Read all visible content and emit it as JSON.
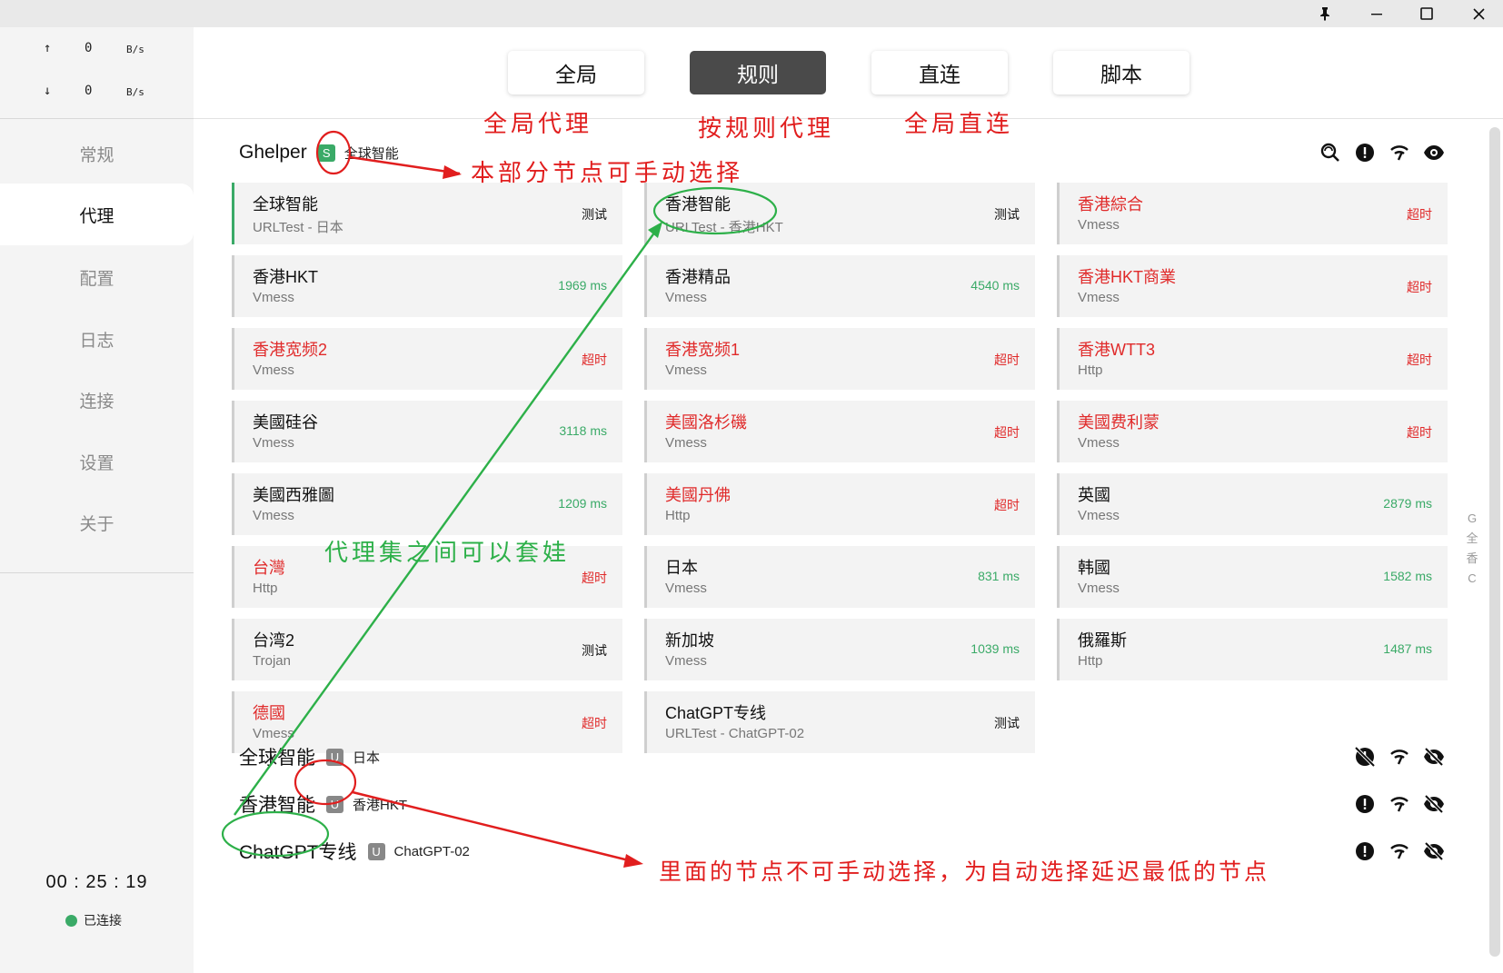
{
  "window": {
    "pin": "🖈",
    "minimize": "—",
    "maximize": "☐",
    "close": "✕"
  },
  "traffic": {
    "up": {
      "arrow": "↑",
      "value": "0",
      "unit": "B/s"
    },
    "down": {
      "arrow": "↓",
      "value": "0",
      "unit": "B/s"
    }
  },
  "sidebar": {
    "items": [
      {
        "label": "常规"
      },
      {
        "label": "代理"
      },
      {
        "label": "配置"
      },
      {
        "label": "日志"
      },
      {
        "label": "连接"
      },
      {
        "label": "设置"
      },
      {
        "label": "关于"
      }
    ],
    "active": "代理",
    "timer": "00 : 25 : 19",
    "status": "已连接",
    "status_color": "#3aaa67"
  },
  "modes": {
    "global": "全局",
    "rule": "规则",
    "direct": "直连",
    "script": "脚本",
    "active": "规则"
  },
  "groups": [
    {
      "name": "Ghelper",
      "badge": "S",
      "now": "全球智能",
      "icons": [
        "search-delay-icon",
        "alert-icon",
        "wifi-icon",
        "eye-icon"
      ],
      "proxies": [
        {
          "name": "全球智能",
          "type": "URLTest - 日本",
          "delay": "测试",
          "status": "test"
        },
        {
          "name": "香港智能",
          "type": "URLTest - 香港HKT",
          "delay": "测试",
          "status": "test"
        },
        {
          "name": "香港綜合",
          "type": "Vmess",
          "delay": "超时",
          "status": "timeout"
        },
        {
          "name": "香港HKT",
          "type": "Vmess",
          "delay": "1969 ms",
          "status": "ok"
        },
        {
          "name": "香港精品",
          "type": "Vmess",
          "delay": "4540 ms",
          "status": "ok"
        },
        {
          "name": "香港HKT商業",
          "type": "Vmess",
          "delay": "超时",
          "status": "timeout"
        },
        {
          "name": "香港宽频2",
          "type": "Vmess",
          "delay": "超时",
          "status": "timeout"
        },
        {
          "name": "香港宽频1",
          "type": "Vmess",
          "delay": "超时",
          "status": "timeout"
        },
        {
          "name": "香港WTT3",
          "type": "Http",
          "delay": "超时",
          "status": "timeout"
        },
        {
          "name": "美國硅谷",
          "type": "Vmess",
          "delay": "3118 ms",
          "status": "ok"
        },
        {
          "name": "美國洛杉磯",
          "type": "Vmess",
          "delay": "超时",
          "status": "timeout"
        },
        {
          "name": "美國费利蒙",
          "type": "Vmess",
          "delay": "超时",
          "status": "timeout"
        },
        {
          "name": "美國西雅圖",
          "type": "Vmess",
          "delay": "1209 ms",
          "status": "ok"
        },
        {
          "name": "美國丹佛",
          "type": "Http",
          "delay": "超时",
          "status": "timeout"
        },
        {
          "name": "英國",
          "type": "Vmess",
          "delay": "2879 ms",
          "status": "ok"
        },
        {
          "name": "台灣",
          "type": "Http",
          "delay": "超时",
          "status": "timeout"
        },
        {
          "name": "日本",
          "type": "Vmess",
          "delay": "831 ms",
          "status": "ok"
        },
        {
          "name": "韩國",
          "type": "Vmess",
          "delay": "1582 ms",
          "status": "ok"
        },
        {
          "name": "台湾2",
          "type": "Trojan",
          "delay": "测试",
          "status": "test"
        },
        {
          "name": "新加坡",
          "type": "Vmess",
          "delay": "1039 ms",
          "status": "ok"
        },
        {
          "name": "俄羅斯",
          "type": "Http",
          "delay": "1487 ms",
          "status": "ok"
        },
        {
          "name": "德國",
          "type": "Vmess",
          "delay": "超时",
          "status": "timeout"
        },
        {
          "name": "ChatGPT专线",
          "type": "URLTest - ChatGPT-02",
          "delay": "测试",
          "status": "test"
        }
      ]
    },
    {
      "name": "全球智能",
      "badge": "U",
      "now": "日本"
    },
    {
      "name": "香港智能",
      "badge": "U",
      "now": "香港HKT"
    },
    {
      "name": "ChatGPT专线",
      "badge": "U",
      "now": "ChatGPT-02"
    }
  ],
  "side_letters": [
    "G",
    "全",
    "香",
    "C"
  ],
  "annotations": {
    "global_proxy": "全局代理",
    "rule_proxy": "按规则代理",
    "global_direct": "全局直连",
    "manual_select": "本部分节点可手动选择",
    "nesting": "代理集之间可以套娃",
    "auto_select": "里面的节点不可手动选择，为自动选择延迟最低的节点"
  },
  "colors": {
    "ok": "#3aaa67",
    "timeout": "#e02a2a",
    "annotation_red": "#e11e1e",
    "annotation_green": "#2db049"
  }
}
